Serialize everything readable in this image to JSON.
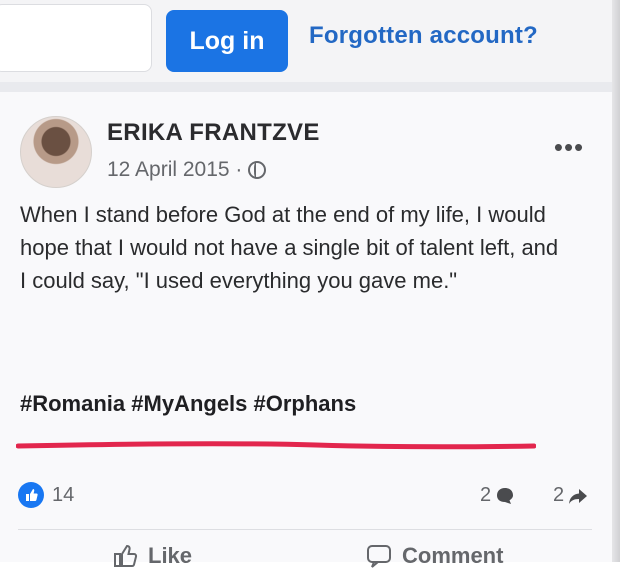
{
  "header": {
    "login_label": "Log in",
    "forgot_label": "Forgotten account?"
  },
  "post": {
    "author": "ERIKA FRANTZVE",
    "date": "12 April 2015 ·",
    "visibility_icon": "globe-icon",
    "more_label": "•••",
    "text": "When I stand before God at the end of my life, I would hope that I would not have a single bit of talent left, and I could say, \"I used everything you gave me.\"",
    "hashtags": "#Romania #MyAngels #Orphans"
  },
  "stats": {
    "reactions_count": "14",
    "comments_count": "2",
    "shares_count": "2"
  },
  "actions": {
    "like_label": "Like",
    "comment_label": "Comment"
  },
  "colors": {
    "brand_blue": "#1b74e4",
    "link_blue": "#2368c4",
    "underline_red": "#e2264d",
    "muted_text": "#65676b"
  }
}
